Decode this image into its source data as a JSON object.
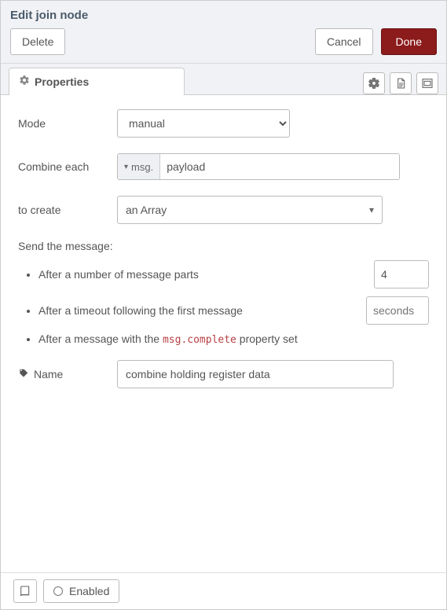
{
  "title": "Edit join node",
  "actions": {
    "delete": "Delete",
    "cancel": "Cancel",
    "done": "Done"
  },
  "tab": {
    "label": "Properties"
  },
  "form": {
    "mode": {
      "label": "Mode",
      "value": "manual"
    },
    "combine": {
      "label": "Combine each",
      "prefix": "msg.",
      "value": "payload"
    },
    "toCreate": {
      "label": "to create",
      "value": "an Array"
    },
    "sendTitle": "Send the message:",
    "afterParts": {
      "text": "After a number of message parts",
      "value": "4"
    },
    "afterTimeout": {
      "text": "After a timeout following the first message",
      "placeholder": "seconds"
    },
    "afterComplete": {
      "before": "After a message with the ",
      "code": "msg.complete",
      "after": " property set"
    },
    "name": {
      "label": "Name",
      "value": "combine holding register data"
    }
  },
  "footer": {
    "enabled": "Enabled"
  }
}
